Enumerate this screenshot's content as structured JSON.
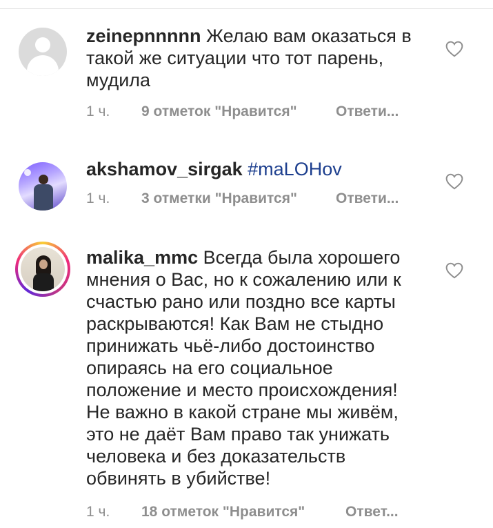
{
  "comments": [
    {
      "username": "zeinepnnnnn",
      "text": "Желаю вам оказаться в такой же ситуации что тот парень, мудила",
      "time": "1 ч.",
      "likes": "9 отметок \"Нравится\"",
      "reply": "Ответи..."
    },
    {
      "username": "akshamov_sirgak",
      "hashtag": "#maLOHov",
      "time": "1 ч.",
      "likes": "3 отметки \"Нравится\"",
      "reply": "Ответи..."
    },
    {
      "username": "malika_mmc",
      "text": "Всегда была хорошего мнения о Вас, но к сожалению или к счастью рано или поздно все карты раскрываются!  Как Вам не стыдно принижать чьё-либо достоинство опираясь на его социальное положение и место происхождения! Не важно в какой стране мы живём, это не даёт Вам право так унижать человека и без доказательств обвинять в убийстве!",
      "time": "1 ч.",
      "likes": "18 отметок \"Нравится\"",
      "reply": "Ответ..."
    }
  ],
  "icons": {
    "like": "heart-outline-icon",
    "default_avatar": "user-silhouette-icon"
  },
  "colors": {
    "meta_text": "#8e8e8e",
    "hashtag": "#1d3f8e",
    "story_ring": [
      "#f9ce34",
      "#ee2a7b",
      "#6228d7"
    ]
  }
}
